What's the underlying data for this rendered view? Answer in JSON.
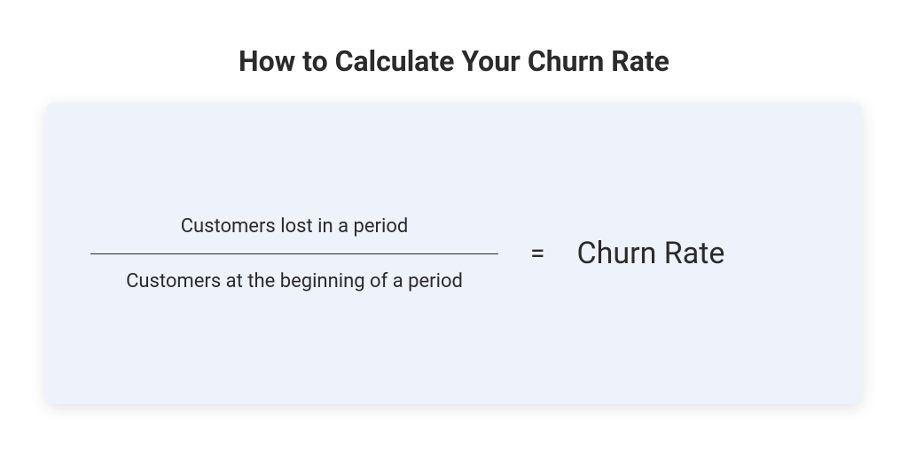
{
  "title": "How to Calculate Your Churn Rate",
  "formula": {
    "numerator": "Customers lost in a period",
    "denominator": "Customers at the beginning of a period",
    "equals": "=",
    "result": "Churn Rate"
  }
}
